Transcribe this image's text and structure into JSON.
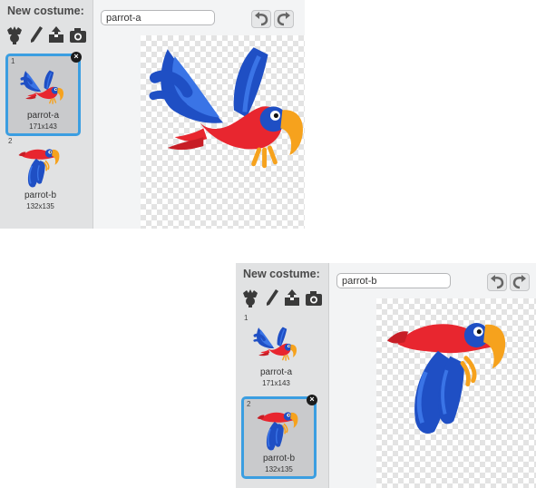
{
  "panels": [
    {
      "new_costume_label": "New costume:",
      "tools": [
        {
          "name": "choose-costume-from-library-icon"
        },
        {
          "name": "paint-new-costume-icon"
        },
        {
          "name": "upload-costume-from-file-icon"
        },
        {
          "name": "new-costume-from-camera-icon"
        }
      ],
      "costumes": [
        {
          "number": "1",
          "name": "parrot-a",
          "size": "171x143",
          "selected": true
        },
        {
          "number": "2",
          "name": "parrot-b",
          "size": "132x135",
          "selected": false
        }
      ],
      "name_field_value": "parrot-a",
      "undo_icon": "undo-icon",
      "redo_icon": "redo-icon",
      "canvas_costume": "parrot-a"
    },
    {
      "new_costume_label": "New costume:",
      "tools": [
        {
          "name": "choose-costume-from-library-icon"
        },
        {
          "name": "paint-new-costume-icon"
        },
        {
          "name": "upload-costume-from-file-icon"
        },
        {
          "name": "new-costume-from-camera-icon"
        }
      ],
      "costumes": [
        {
          "number": "1",
          "name": "parrot-a",
          "size": "171x143",
          "selected": false
        },
        {
          "number": "2",
          "name": "parrot-b",
          "size": "132x135",
          "selected": true
        }
      ],
      "name_field_value": "parrot-b",
      "undo_icon": "undo-icon",
      "redo_icon": "redo-icon",
      "canvas_costume": "parrot-b"
    }
  ],
  "colors": {
    "selection_blue": "#3b9ee1",
    "sidebar_gray": "#e1e2e3",
    "parrot_red": "#e8262f",
    "parrot_blue": "#1f4fc4",
    "parrot_orange": "#f6a21d"
  }
}
